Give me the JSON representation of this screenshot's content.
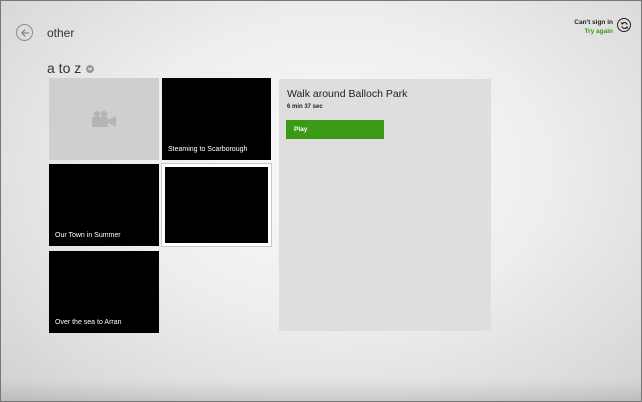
{
  "header": {
    "title": "other"
  },
  "account": {
    "cant_sign_in": "Can't sign in",
    "try_again": "Try again"
  },
  "section": {
    "title": "a to z"
  },
  "tiles": [
    {
      "title": ""
    },
    {
      "title": "Steaming to Scarborough"
    },
    {
      "title": "Our Town in Summer"
    },
    {
      "title": ""
    },
    {
      "title": "Over the sea to Arran"
    }
  ],
  "detail": {
    "title": "Walk around Balloch Park",
    "duration": "6 min 37 sec",
    "play_label": "Play"
  },
  "icons": {
    "back": "back-arrow-icon",
    "sync": "sync-icon",
    "chevron": "chevron-down-icon",
    "video": "video-camera-icon"
  },
  "colors": {
    "accent": "#3a9a16",
    "tile": "#000000"
  }
}
